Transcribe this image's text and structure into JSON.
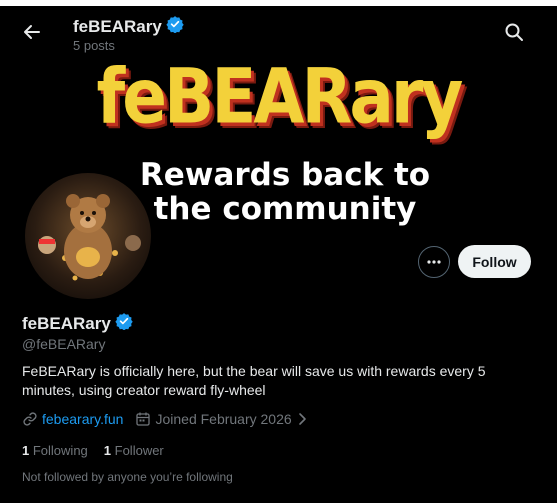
{
  "header": {
    "name": "feBEARary",
    "posts": "5 posts"
  },
  "banner": {
    "title": "feBEARary",
    "subtitle": "Rewards back to the community"
  },
  "actions": {
    "follow": "Follow"
  },
  "profile": {
    "name": "feBEARary",
    "handle": "@feBEARary",
    "bio": "FeBEARary is officially here, but the bear will save us with rewards every 5 minutes, using creator reward fly-wheel",
    "website": "febearary.fun",
    "joined": "Joined February 2026"
  },
  "stats": {
    "following_count": "1",
    "following_label": "Following",
    "followers_count": "1",
    "followers_label": "Follower"
  },
  "notice": "Not followed by anyone you’re following",
  "colors": {
    "accent": "#1d9bf0",
    "banner_title": "#f3d13a",
    "banner_shadow": "#c0311f"
  },
  "icons": [
    "back-arrow-icon",
    "verified-badge-icon",
    "search-icon",
    "more-icon",
    "link-icon",
    "calendar-icon",
    "chevron-right-icon"
  ]
}
